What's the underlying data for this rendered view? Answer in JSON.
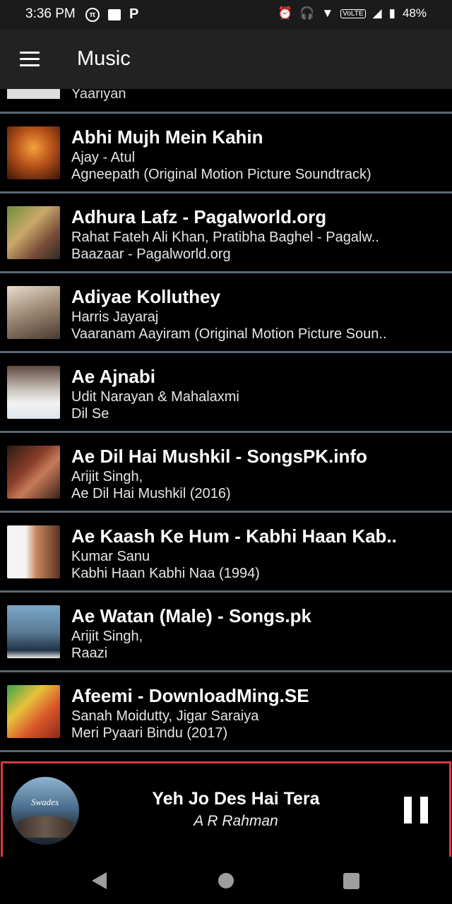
{
  "status_bar": {
    "time": "3:36 PM",
    "battery": "48%",
    "left_icons": [
      "pi-icon",
      "image-icon",
      "p-icon"
    ],
    "right_icons": [
      "alarm-icon",
      "headset-icon",
      "wifi-icon",
      "volte-icon",
      "signal-icon",
      "battery-icon"
    ]
  },
  "toolbar": {
    "title": "Music",
    "menu_icon": "hamburger-icon"
  },
  "list": {
    "partial_item": {
      "album": "Yaariyan"
    },
    "items": [
      {
        "title": "Abhi Mujh Mein Kahin",
        "artist": "Ajay - Atul",
        "album": "Agneepath (Original Motion Picture Soundtrack)"
      },
      {
        "title": "Adhura Lafz - Pagalworld.org",
        "artist": "Rahat Fateh Ali Khan, Pratibha Baghel - Pagalw..",
        "album": "Baazaar - Pagalworld.org"
      },
      {
        "title": "Adiyae Kolluthey",
        "artist": "Harris Jayaraj",
        "album": "Vaaranam Aayiram (Original Motion Picture Soun.."
      },
      {
        "title": "Ae Ajnabi",
        "artist": "Udit Narayan & Mahalaxmi",
        "album": "Dil Se"
      },
      {
        "title": "Ae Dil Hai Mushkil - SongsPK.info",
        "artist": "Arijit Singh,",
        "album": "Ae Dil Hai Mushkil (2016)"
      },
      {
        "title": "Ae Kaash Ke Hum - Kabhi Haan Kab..",
        "artist": "Kumar Sanu",
        "album": "Kabhi Haan Kabhi Naa (1994)"
      },
      {
        "title": "Ae Watan (Male) - Songs.pk",
        "artist": "Arijit Singh,",
        "album": "Raazi"
      },
      {
        "title": "Afeemi -  DownloadMing.SE",
        "artist": "Sanah Moidutty, Jigar Saraiya",
        "album": "Meri Pyaari Bindu (2017)"
      }
    ]
  },
  "now_playing": {
    "title": "Yeh Jo Des Hai Tera",
    "artist": "A R Rahman",
    "art_label": "Swades",
    "control_icon": "pause-icon"
  },
  "nav_bar": {
    "buttons": [
      "back-icon",
      "home-icon",
      "recents-icon"
    ]
  }
}
